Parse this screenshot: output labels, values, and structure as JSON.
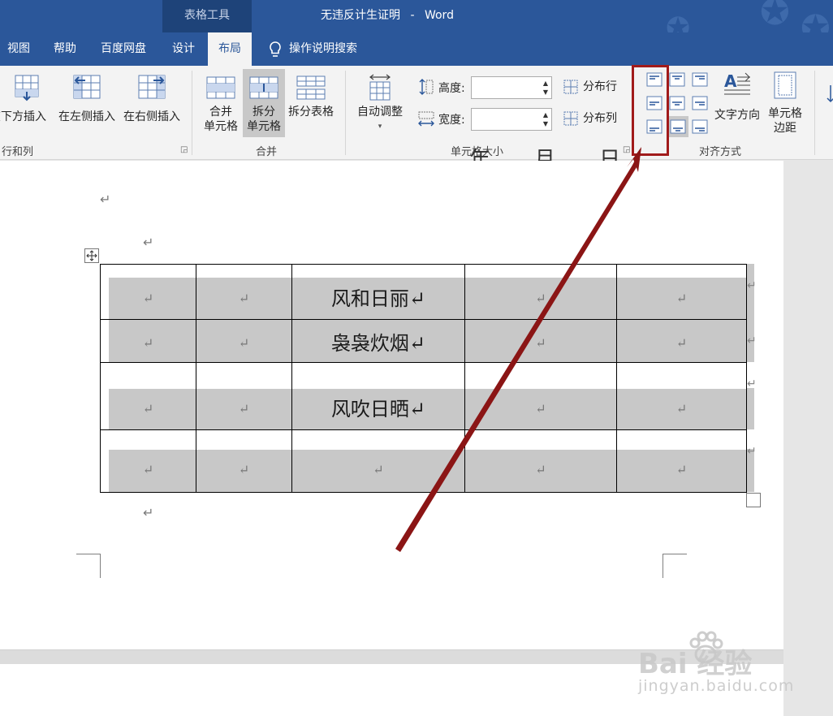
{
  "window": {
    "context_tab": "表格工具",
    "doc_title": "无违反计生证明",
    "app_name": "Word",
    "title_separator": "-"
  },
  "tabs": [
    {
      "label": "视图"
    },
    {
      "label": "帮助"
    },
    {
      "label": "百度网盘"
    },
    {
      "label": "设计"
    },
    {
      "label": "布局",
      "active": true
    },
    {
      "label": "操作说明搜索"
    }
  ],
  "ribbon": {
    "rows_cols": {
      "insert_below": "在下方插入",
      "insert_left": "在左侧插入",
      "insert_right": "在右侧插入",
      "group_label": "行和列"
    },
    "merge": {
      "merge_cells": [
        "合并",
        "单元格"
      ],
      "split_cells": [
        "拆分",
        "单元格"
      ],
      "split_table": "拆分表格",
      "group_label": "合并"
    },
    "cell_size": {
      "autofit": "自动调整",
      "height_label": "高度:",
      "width_label": "宽度:",
      "height_value": "",
      "width_value": "",
      "distribute_rows": "分布行",
      "distribute_cols": "分布列",
      "group_label": "单元格大小"
    },
    "alignment": {
      "text_direction": "文字方向",
      "cell_margins": [
        "单元格",
        "边距"
      ],
      "group_label": "对齐方式"
    }
  },
  "document": {
    "heading_cut": [
      "年",
      "月",
      "日"
    ],
    "paragraph_mark": "↵",
    "table": [
      [
        "↵",
        "↵",
        "风和日丽↵",
        "↵",
        "↵"
      ],
      [
        "↵",
        "↵",
        "袅袅炊烟↵",
        "↵",
        "↵"
      ],
      [
        "↵",
        "↵",
        "风吹日晒↵",
        "↵",
        "↵"
      ],
      [
        "↵",
        "↵",
        "↵",
        "↵",
        "↵"
      ]
    ]
  },
  "watermark": {
    "main": "Bai 经验",
    "sub": "jingyan.baidu.com"
  },
  "colors": {
    "title_bar": "#2b579a",
    "ribbon_bg": "#f3f3f3",
    "shade": "#c8c8c8",
    "annotation": "#8b1515"
  }
}
